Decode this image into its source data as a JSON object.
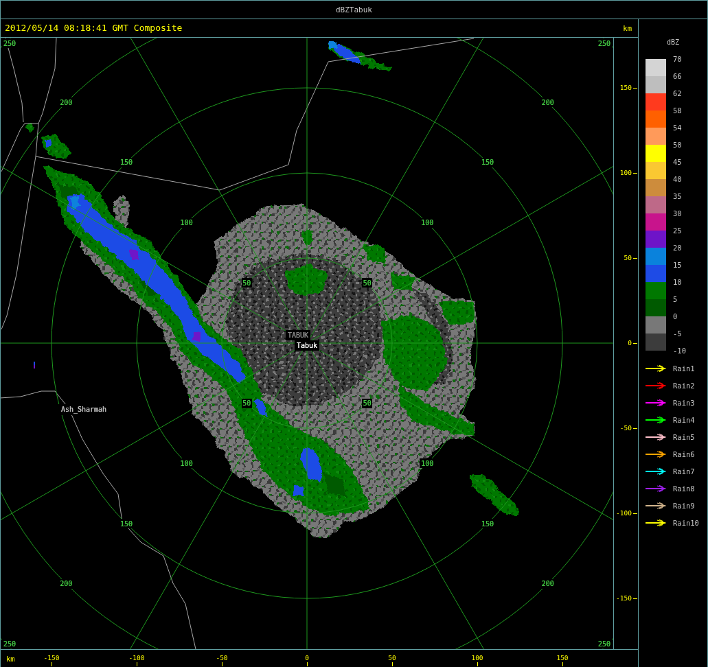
{
  "window": {
    "title": "dBZTabuk"
  },
  "header": {
    "timestamp": "2012/05/14 08:18:41 GMT Composite",
    "unit": "km"
  },
  "plot": {
    "range_rings": [
      {
        "labels": [
          "50",
          "50",
          "50",
          "50"
        ]
      },
      {
        "labels": [
          "100",
          "100",
          "100",
          "100"
        ]
      },
      {
        "labels": [
          "150",
          "150",
          "150",
          "150"
        ]
      },
      {
        "labels": [
          "200",
          "200",
          "200",
          "200"
        ]
      },
      {
        "labels": [
          "250",
          "250",
          "250",
          "250"
        ]
      }
    ],
    "places": [
      {
        "name": "TABUK",
        "kind": "station"
      },
      {
        "name": "Tabuk",
        "kind": "city"
      },
      {
        "name": "Ash_Sharmah",
        "kind": "town"
      }
    ]
  },
  "y_axis": {
    "ticks": [
      "150",
      "100",
      "50",
      "0",
      "-50",
      "-100",
      "-150"
    ]
  },
  "x_axis": {
    "unit": "km",
    "ticks": [
      "-150",
      "-100",
      "-50",
      "0",
      "50",
      "100",
      "150"
    ]
  },
  "legend": {
    "title": "dBZ",
    "bands": [
      {
        "color": "#d4d4d4"
      },
      {
        "color": "#bebebe"
      },
      {
        "color": "#ff3a1e"
      },
      {
        "color": "#ff6000"
      },
      {
        "color": "#ff9a5a"
      },
      {
        "color": "#ffff00"
      },
      {
        "color": "#fac832"
      },
      {
        "color": "#cd8c3c"
      },
      {
        "color": "#be6988"
      },
      {
        "color": "#c8148c"
      },
      {
        "color": "#6e14c8"
      },
      {
        "color": "#0a82dc"
      },
      {
        "color": "#1e4be6"
      },
      {
        "color": "#007800"
      },
      {
        "color": "#005a00"
      },
      {
        "color": "#787878"
      },
      {
        "color": "#3c3c3c"
      }
    ],
    "labels": [
      "70",
      "66",
      "62",
      "58",
      "54",
      "50",
      "45",
      "40",
      "35",
      "30",
      "25",
      "20",
      "15",
      "10",
      "5",
      "0",
      "-5",
      "-10"
    ]
  },
  "tracks": [
    {
      "label": "Rain1",
      "color": "#ffff00"
    },
    {
      "label": "Rain2",
      "color": "#ff0000"
    },
    {
      "label": "Rain3",
      "color": "#ff00ff"
    },
    {
      "label": "Rain4",
      "color": "#00ff00"
    },
    {
      "label": "Rain5",
      "color": "#ffc0cb"
    },
    {
      "label": "Rain6",
      "color": "#ffa500"
    },
    {
      "label": "Rain7",
      "color": "#00ffff"
    },
    {
      "label": "Rain8",
      "color": "#a020f0"
    },
    {
      "label": "Rain9",
      "color": "#d2b48c"
    },
    {
      "label": "Rain10",
      "color": "#ffff00"
    }
  ]
}
